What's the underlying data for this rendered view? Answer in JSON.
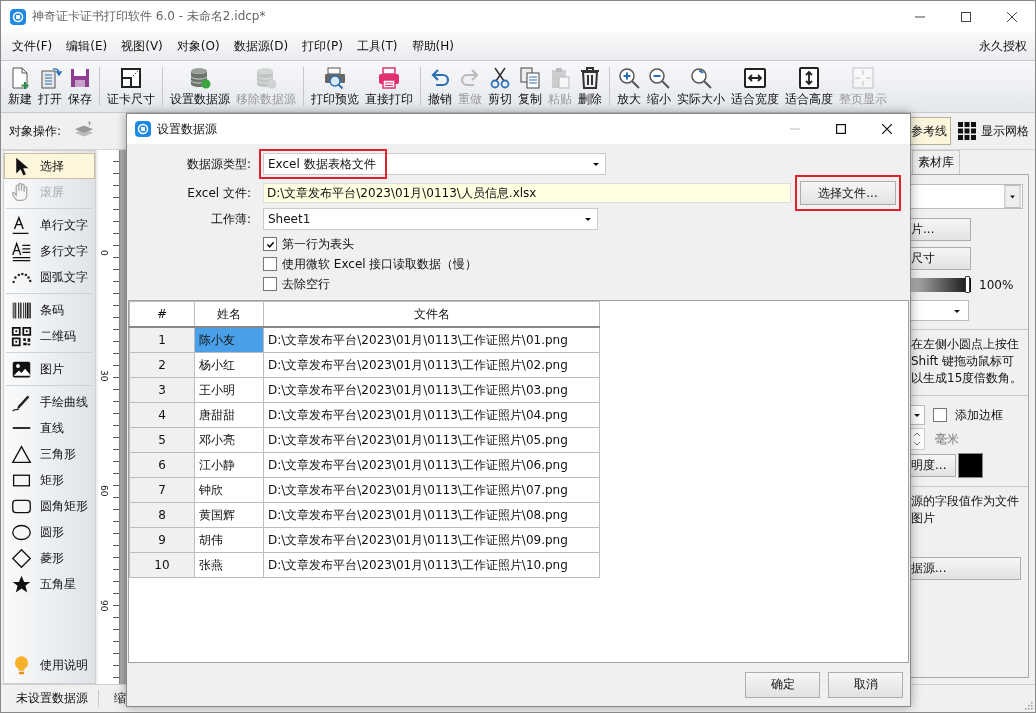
{
  "window": {
    "title": "神奇证卡证书打印软件 6.0 - 未命名2.idcp*"
  },
  "menu": [
    "文件(F)",
    "编辑(E)",
    "视图(V)",
    "对象(O)",
    "数据源(D)",
    "打印(P)",
    "工具(T)",
    "帮助(H)"
  ],
  "license": "永久授权",
  "toolbar": [
    [
      {
        "label": "新建",
        "disabled": false
      },
      {
        "label": "打开",
        "disabled": false
      },
      {
        "label": "保存",
        "disabled": false
      }
    ],
    [
      {
        "label": "证卡尺寸",
        "disabled": false
      }
    ],
    [
      {
        "label": "设置数据源",
        "disabled": false
      },
      {
        "label": "移除数据源",
        "disabled": true
      }
    ],
    [
      {
        "label": "打印预览",
        "disabled": false
      },
      {
        "label": "直接打印",
        "disabled": false
      }
    ],
    [
      {
        "label": "撤销",
        "disabled": false
      },
      {
        "label": "重做",
        "disabled": true
      },
      {
        "label": "剪切",
        "disabled": false
      },
      {
        "label": "复制",
        "disabled": false
      },
      {
        "label": "粘贴",
        "disabled": true
      },
      {
        "label": "删除",
        "disabled": false
      }
    ],
    [
      {
        "label": "放大",
        "disabled": false
      },
      {
        "label": "缩小",
        "disabled": false
      },
      {
        "label": "实际大小",
        "disabled": false
      },
      {
        "label": "适合宽度",
        "disabled": false
      },
      {
        "label": "适合高度",
        "disabled": false
      },
      {
        "label": "整页显示",
        "disabled": true
      }
    ]
  ],
  "object_bar": {
    "label": "对象操作:",
    "guides": {
      "label": "参考线",
      "on": true
    },
    "grid": {
      "label": "显示网格",
      "on": false
    }
  },
  "toolbox": [
    [
      {
        "label": "选择",
        "selected": true,
        "disabled": false
      },
      {
        "label": "滚屏",
        "selected": false,
        "disabled": true
      }
    ],
    [
      {
        "label": "单行文字",
        "selected": false,
        "disabled": false
      },
      {
        "label": "多行文字",
        "selected": false,
        "disabled": false
      },
      {
        "label": "圆弧文字",
        "selected": false,
        "disabled": false
      }
    ],
    [
      {
        "label": "条码",
        "selected": false,
        "disabled": false
      },
      {
        "label": "二维码",
        "selected": false,
        "disabled": false
      }
    ],
    [
      {
        "label": "图片",
        "selected": false,
        "disabled": false
      }
    ],
    [
      {
        "label": "手绘曲线",
        "selected": false,
        "disabled": false
      },
      {
        "label": "直线",
        "selected": false,
        "disabled": false
      },
      {
        "label": "三角形",
        "selected": false,
        "disabled": false
      },
      {
        "label": "矩形",
        "selected": false,
        "disabled": false
      },
      {
        "label": "圆角矩形",
        "selected": false,
        "disabled": false
      },
      {
        "label": "圆形",
        "selected": false,
        "disabled": false
      },
      {
        "label": "菱形",
        "selected": false,
        "disabled": false
      },
      {
        "label": "五角星",
        "selected": false,
        "disabled": false
      }
    ]
  ],
  "help": "使用说明",
  "ruler": {
    "labels": [
      "0",
      "30",
      "60",
      "90"
    ]
  },
  "right_panel": {
    "tab": "素材库",
    "button_1": "片...",
    "button_2": "尺寸",
    "slider": {
      "level": 1,
      "reading": "100%"
    },
    "hint": [
      "在左侧小圆点上按住",
      "Shift 键拖动鼠标可",
      "以生成15度倍数角。"
    ],
    "border": {
      "label": "添加边框",
      "checked": false
    },
    "unit": "毫米",
    "button_3": "明度...",
    "swatch": {
      "color": "#000000"
    },
    "note": [
      "源的字段值作为文件",
      "图片"
    ],
    "button_4": "据源..."
  },
  "status_bar": [
    "未设置数据源",
    "缩"
  ],
  "dialog": {
    "title": "设置数据源",
    "type": {
      "label": "数据源类型:",
      "value": "Excel 数据表格文件",
      "highlighted": true
    },
    "file": {
      "label": "Excel 文件:",
      "value": "D:\\文章发布平台\\2023\\01月\\0113\\人员信息.xlsx",
      "button": "选择文件...",
      "highlighted": true
    },
    "sheet": {
      "label": "工作薄:",
      "value": "Sheet1"
    },
    "options": [
      {
        "label": "第一行为表头",
        "checked": true
      },
      {
        "label": "使用微软 Excel 接口读取数据（慢）",
        "checked": false
      },
      {
        "label": "去除空行",
        "checked": false
      }
    ],
    "columns": [
      "#",
      "姓名",
      "文件名"
    ],
    "rows": [
      {
        "num": "1",
        "name": "陈小友",
        "file": "D:\\文章发布平台\\2023\\01月\\0113\\工作证照片\\01.png",
        "selected": true
      },
      {
        "num": "2",
        "name": "杨小红",
        "file": "D:\\文章发布平台\\2023\\01月\\0113\\工作证照片\\02.png",
        "selected": false
      },
      {
        "num": "3",
        "name": "王小明",
        "file": "D:\\文章发布平台\\2023\\01月\\0113\\工作证照片\\03.png",
        "selected": false
      },
      {
        "num": "4",
        "name": "唐甜甜",
        "file": "D:\\文章发布平台\\2023\\01月\\0113\\工作证照片\\04.png",
        "selected": false
      },
      {
        "num": "5",
        "name": "邓小亮",
        "file": "D:\\文章发布平台\\2023\\01月\\0113\\工作证照片\\05.png",
        "selected": false
      },
      {
        "num": "6",
        "name": "江小静",
        "file": "D:\\文章发布平台\\2023\\01月\\0113\\工作证照片\\06.png",
        "selected": false
      },
      {
        "num": "7",
        "name": "钟欣",
        "file": "D:\\文章发布平台\\2023\\01月\\0113\\工作证照片\\07.png",
        "selected": false
      },
      {
        "num": "8",
        "name": "黄国辉",
        "file": "D:\\文章发布平台\\2023\\01月\\0113\\工作证照片\\08.png",
        "selected": false
      },
      {
        "num": "9",
        "name": "胡伟",
        "file": "D:\\文章发布平台\\2023\\01月\\0113\\工作证照片\\09.png",
        "selected": false
      },
      {
        "num": "10",
        "name": "张燕",
        "file": "D:\\文章发布平台\\2023\\01月\\0113\\工作证照片\\10.png",
        "selected": false
      }
    ],
    "buttons": [
      "确定",
      "取消"
    ]
  }
}
